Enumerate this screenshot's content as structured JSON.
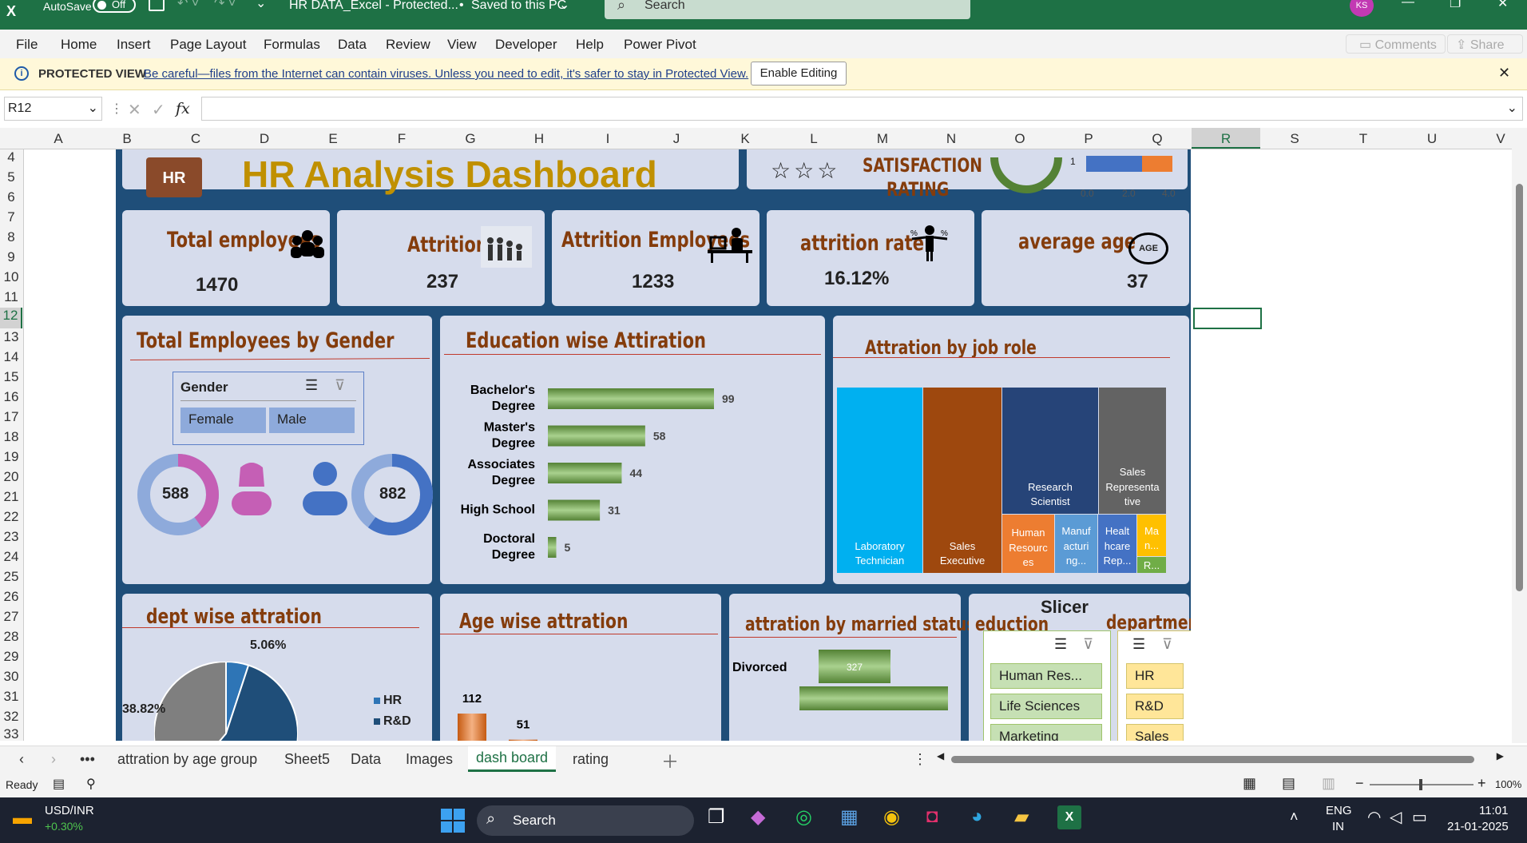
{
  "titlebar": {
    "autosave": "AutoSave",
    "autosave_state": "Off",
    "filename": "HR DATA_Excel  -  Protected...",
    "saved": "Saved to this PC",
    "search": "Search",
    "user": "KS"
  },
  "menu": [
    "File",
    "Home",
    "Insert",
    "Page Layout",
    "Formulas",
    "Data",
    "Review",
    "View",
    "Developer",
    "Help",
    "Power Pivot"
  ],
  "menu_right": {
    "comments": "Comments",
    "share": "Share"
  },
  "protected": {
    "label": "PROTECTED VIEW",
    "message": "Be careful—files from the Internet can contain viruses. Unless you need to edit, it's safer to stay in Protected View.",
    "button": "Enable Editing"
  },
  "formula": {
    "namebox": "R12",
    "fx": "fx",
    "value": ""
  },
  "columns": [
    "A",
    "B",
    "C",
    "D",
    "E",
    "F",
    "G",
    "H",
    "I",
    "J",
    "K",
    "L",
    "M",
    "N",
    "O",
    "P",
    "Q",
    "R",
    "S",
    "T",
    "U",
    "V"
  ],
  "rows": [
    "4",
    "5",
    "6",
    "7",
    "8",
    "9",
    "10",
    "11",
    "12",
    "13",
    "14",
    "15",
    "16",
    "17",
    "18",
    "19",
    "20",
    "21",
    "22",
    "23",
    "24",
    "25",
    "26",
    "27",
    "28",
    "29",
    "30",
    "31",
    "32",
    "33"
  ],
  "dashboard": {
    "title": "HR Analysis Dashboard",
    "logo": "HR",
    "satisfaction": {
      "label_1": "SATISFACTION",
      "label_2": "RATING",
      "bar_label": "1",
      "axis": [
        "0.0",
        "2.0",
        "4.0"
      ]
    },
    "kpis": [
      {
        "label": "Total employees",
        "value": "1470",
        "icon": "people-group-icon"
      },
      {
        "label": "Attrition",
        "value": "237",
        "icon": "people-leaving-icon"
      },
      {
        "label": "Attrition Employees",
        "value": "1233",
        "icon": "desk-worker-icon"
      },
      {
        "label": "attrition rate",
        "value": "16.12%",
        "icon": "balance-person-icon"
      },
      {
        "label": "average age",
        "value": "37",
        "icon": "age-badge-icon",
        "badge": "AGE"
      }
    ],
    "gender": {
      "title": "Total Employees by Gender",
      "slicer_title": "Gender",
      "options": [
        "Female",
        "Male"
      ],
      "female_count": "588",
      "male_count": "882"
    },
    "education": {
      "title": "Education wise Attiration"
    },
    "jobrole": {
      "title": "Attration by job role"
    },
    "dept": {
      "title": "dept wise attration",
      "labels": [
        "5.06%",
        "38.82%"
      ],
      "legend": [
        "HR",
        "R&D"
      ]
    },
    "age": {
      "title": "Age wise attration"
    },
    "married": {
      "title": "attration by married status"
    },
    "slicer_panel": {
      "title": "Slicer",
      "edu_title": "eduction",
      "dept_title": "department",
      "edu_items": [
        "Human Res...",
        "Life Sciences",
        "Marketing"
      ],
      "dept_items": [
        "HR",
        "R&D",
        "Sales"
      ]
    }
  },
  "chart_data": [
    {
      "type": "bar",
      "title": "Education wise Attiration",
      "categories": [
        "Bachelor's Degree",
        "Master's Degree",
        "Associates Degree",
        "High School",
        "Doctoral Degree"
      ],
      "values": [
        99,
        58,
        44,
        31,
        5
      ]
    },
    {
      "type": "treemap",
      "title": "Attration by job role",
      "categories": [
        "Laboratory Technician",
        "Sales Executive",
        "Research Scientist",
        "Sales Representative",
        "Human Resources",
        "Manufacturing...",
        "Healthcare Rep...",
        "Ma...",
        "R..."
      ],
      "colors": [
        "#00b0f0",
        "#9e480e",
        "#264478",
        "#636363",
        "#ed7d31",
        "#5b9bd5",
        "#4472c4",
        "#ffc000",
        "#70ad47"
      ]
    },
    {
      "type": "pie",
      "title": "dept wise attration",
      "categories": [
        "HR",
        "R&D",
        "Sales"
      ],
      "values": [
        5.06,
        56.12,
        38.82
      ]
    },
    {
      "type": "bar",
      "title": "Age wise attration",
      "values": [
        112,
        51
      ]
    },
    {
      "type": "bar",
      "title": "attration by married status",
      "categories": [
        "Divorced"
      ],
      "values": [
        327
      ]
    }
  ],
  "sheets": {
    "tabs": [
      "attration by age group",
      "Sheet5",
      "Data",
      "Images",
      "dash board",
      "rating"
    ],
    "active": "dash board"
  },
  "status": {
    "ready": "Ready",
    "zoom": "100%"
  },
  "taskbar": {
    "ticker": "USD/INR",
    "change": "+0.30%",
    "search": "Search",
    "lang1": "ENG",
    "lang2": "IN",
    "time": "11:01",
    "date": "21-01-2025"
  }
}
